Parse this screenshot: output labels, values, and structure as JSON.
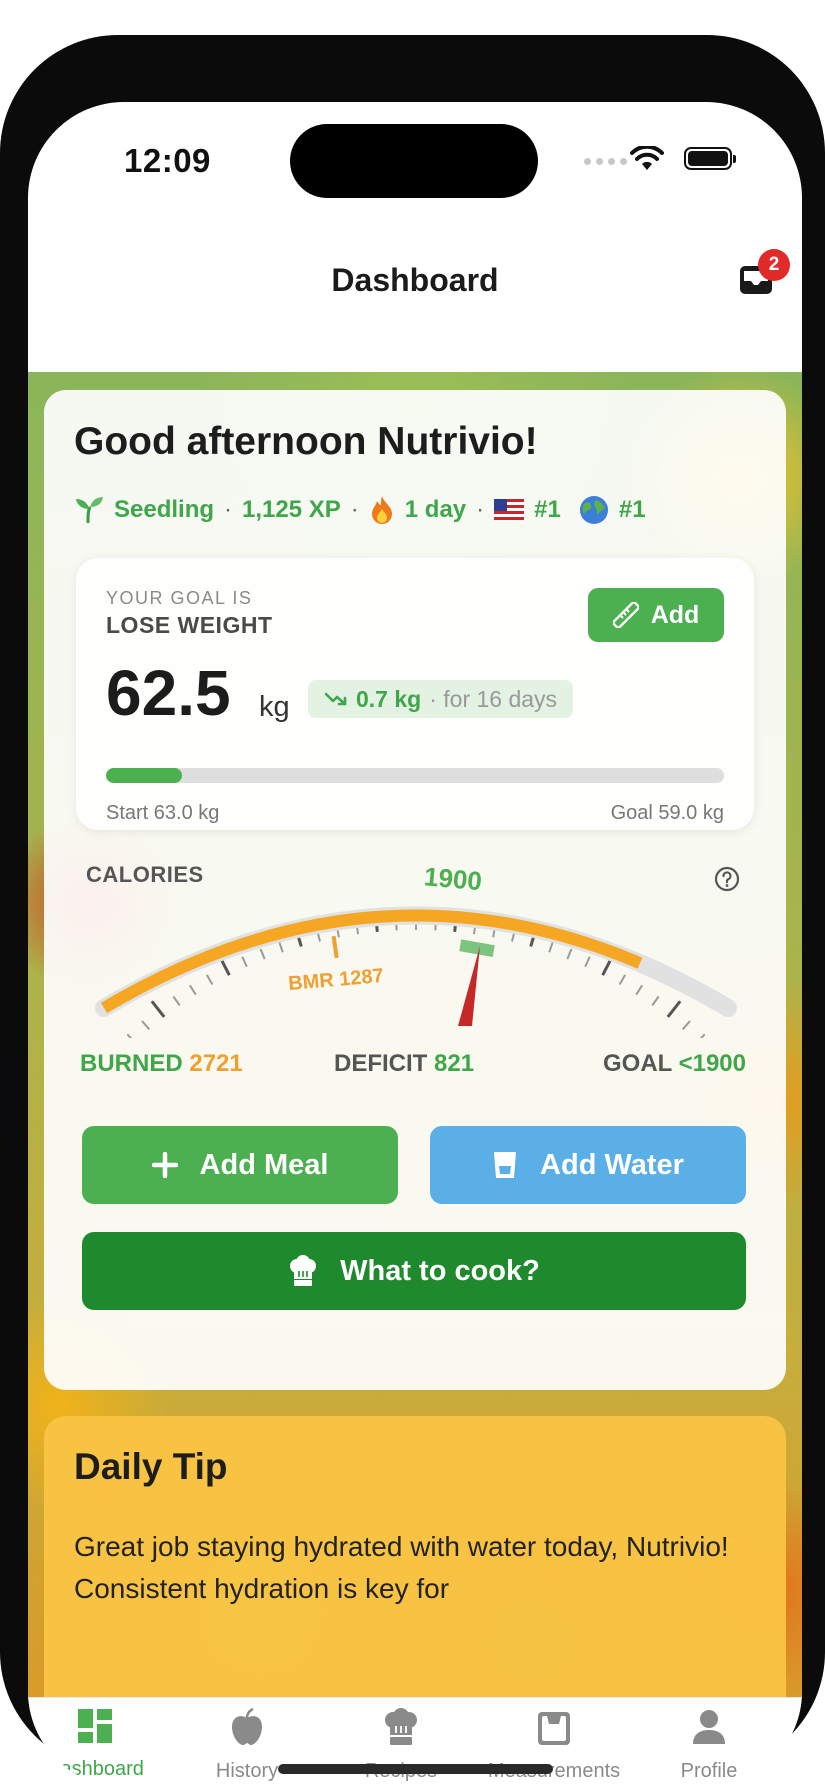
{
  "status_bar": {
    "time": "12:09"
  },
  "header": {
    "title": "Dashboard",
    "inbox_badge": "2"
  },
  "greeting": "Good afternoon Nutrivio!",
  "stats": {
    "level": "Seedling",
    "xp": "1,125 XP",
    "streak": "1 day",
    "country_rank": "#1",
    "global_rank": "#1",
    "separator": "·"
  },
  "goal": {
    "pre_label": "YOUR GOAL IS",
    "label": "LOSE WEIGHT",
    "add_label": "Add",
    "weight": "62.5",
    "unit": "kg",
    "change": "0.7 kg",
    "change_period": "· for 16 days",
    "progress": 0.1229,
    "start_label": "Start 63.0 kg",
    "goal_label": "Goal 59.0 kg"
  },
  "calories": {
    "title": "CALORIES",
    "goal_marker": "1900",
    "bmr_label": "BMR 1287",
    "burned_label": "BURNED",
    "burned_value": "2721",
    "deficit_label": "DEFICIT",
    "deficit_value": "821",
    "goal_label": "GOAL",
    "goal_value": "<1900"
  },
  "actions": {
    "add_meal": "Add Meal",
    "add_water": "Add Water",
    "what_to_cook": "What to cook?"
  },
  "tip": {
    "title": "Daily Tip",
    "body": "Great job staying hydrated with water today, Nutrivio! Consistent hydration is key for"
  },
  "tabs": [
    {
      "label": "Dashboard",
      "icon": "dashboard-icon",
      "active": true
    },
    {
      "label": "History",
      "icon": "apple-icon",
      "active": false
    },
    {
      "label": "Recipes",
      "icon": "chef-hat-icon",
      "active": false
    },
    {
      "label": "Measurements",
      "icon": "scale-icon",
      "active": false
    },
    {
      "label": "Profile",
      "icon": "person-icon",
      "active": false
    }
  ],
  "colors": {
    "green": "#4caf50",
    "dark_green": "#1f8a2d",
    "blue": "#5aafe6",
    "orange": "#f0a030",
    "tip_yellow": "#fac443",
    "badge_red": "#e12a2a"
  }
}
